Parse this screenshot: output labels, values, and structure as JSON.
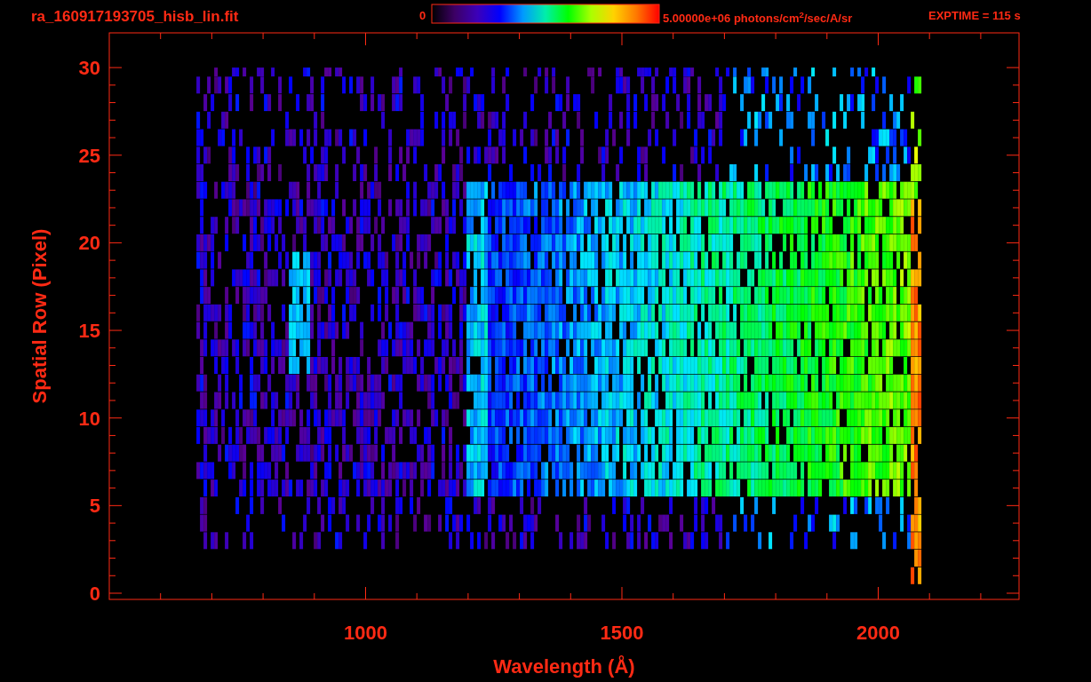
{
  "header": {
    "title": "ra_160917193705_hisb_lin.fit",
    "colorbar_min": "0",
    "colorbar_max": "5.00000e+06 photons/cm$^{2}$/sec/A/sr",
    "exptime": "EXPTIME = 115 s"
  },
  "plot": {
    "ylabel": "Spatial Row (Pixel)",
    "yticks": [
      "30",
      "25",
      "20",
      "15",
      "10",
      "5",
      "0"
    ],
    "xlabel": "Wavelength (Å)",
    "xticks": [
      "1000",
      "1500",
      "2000"
    ]
  }
}
